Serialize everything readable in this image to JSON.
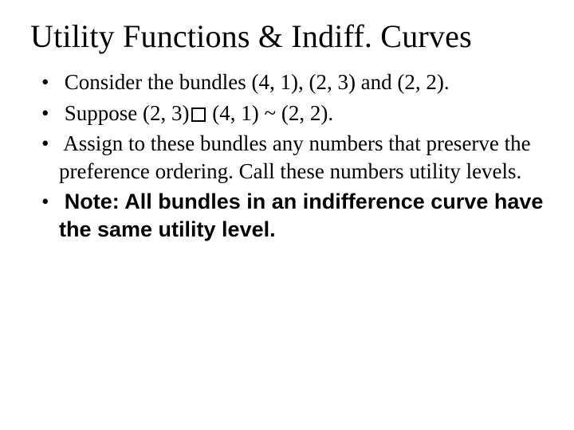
{
  "title": "Utility Functions & Indiff. Curves",
  "bullets": {
    "b1": "Consider the bundles (4, 1), (2, 3) and (2, 2).",
    "b2a": "Suppose (2, 3)",
    "b2b": " (4, 1) ~ (2, 2).",
    "b3": "Assign to these bundles any numbers that preserve the preference ordering. Call these numbers utility levels.",
    "b4": "Note: All bundles in an indifference curve have the same utility level."
  }
}
